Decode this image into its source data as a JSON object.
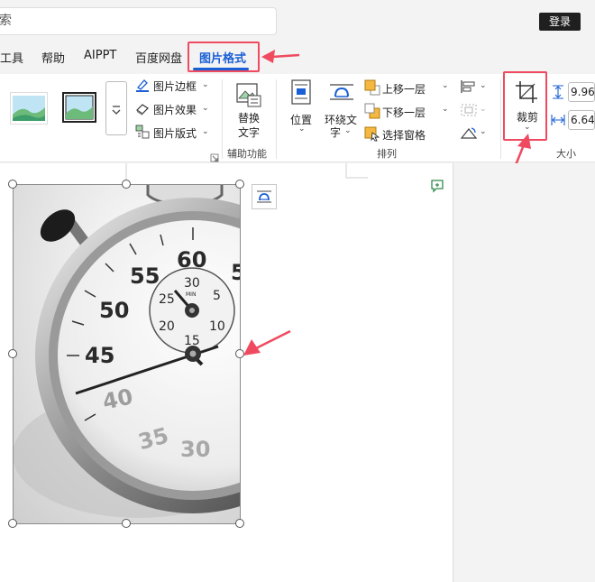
{
  "topbar": {
    "search_text": "索",
    "login_label": "登录"
  },
  "tabs": [
    {
      "label": "工具"
    },
    {
      "label": "帮助"
    },
    {
      "label": "AIPPT"
    },
    {
      "label": "百度网盘"
    },
    {
      "label": "图片格式",
      "active": true
    }
  ],
  "ribbon": {
    "picture_styles": {
      "border_label": "图片边框",
      "effects_label": "图片效果",
      "layout_label": "图片版式"
    },
    "accessibility": {
      "alt_text_line1": "替换",
      "alt_text_line2": "文字",
      "group_label": "辅助功能"
    },
    "arrange": {
      "position_label": "位置",
      "wrap_text_line1": "环绕文",
      "wrap_text_line2": "字",
      "bring_forward_label": "上移一层",
      "send_backward_label": "下移一层",
      "selection_pane_label": "选择窗格",
      "group_label": "排列"
    },
    "size": {
      "crop_label": "裁剪",
      "height_value": "9.96",
      "width_value": "6.64",
      "group_label": "大小"
    }
  },
  "stopwatch": {
    "dial_labels": [
      "60",
      "55",
      "50",
      "45",
      "40",
      "35",
      "30",
      "5"
    ],
    "subdial_labels": [
      "30",
      "25",
      "20",
      "15",
      "10",
      "5"
    ],
    "subdial_mark": "MIN"
  },
  "colors": {
    "accent": "#1a5fd6",
    "annotation": "#ef4a60",
    "login_bg": "#1f1f1f"
  }
}
